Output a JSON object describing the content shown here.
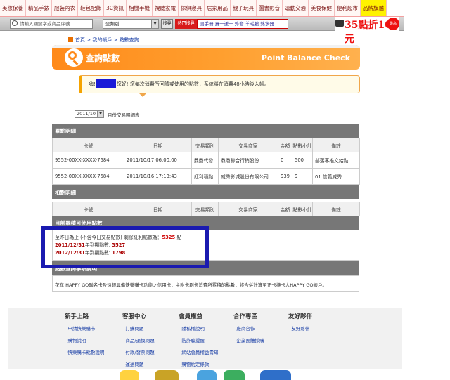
{
  "top_links": "",
  "category_nav": [
    "美妝保養",
    "精品手錶",
    "服裝內衣",
    "鞋包配飾",
    "3C資訊",
    "相機手機",
    "視聽家電",
    "傢俱寢具",
    "居家用品",
    "親子玩具",
    "圖書影音",
    "運動交通",
    "美食保健",
    "便利超市",
    "品牌旗艦"
  ],
  "search": {
    "placeholder": "請輸入關鍵字或商品序號",
    "category": "全類別",
    "button": "搜尋",
    "hot_label": "熱門搜尋",
    "hot_keywords": "國手冊 買一送一 外套 羊毛被 熱水器"
  },
  "promo": {
    "text": "35點折10元",
    "badge": "最高100%"
  },
  "breadcrumb": "首頁 > 我的帳戶 > 點數查詢",
  "banner": {
    "title": "查詢點數",
    "subtitle": "Point Balance Check"
  },
  "greeting": {
    "prefix": "嗨!",
    "suffix": "您好! 您每次消費所回饋或使用的點數，系統將在消費48小時後入帳。"
  },
  "month_select": {
    "value": "2011/10",
    "label": "月份交易明細表"
  },
  "earn_section": {
    "title": "累點明細",
    "columns": [
      "卡號",
      "日期",
      "交易類別",
      "交易商家",
      "金額",
      "點數小計",
      "備註"
    ],
    "rows": [
      [
        "9552-00XX-XXXX-7684",
        "2011/10/17 06:00:00",
        "鼎鼎代發",
        "鼎鼎聯合行銷股份",
        "0",
        "500",
        "部落客推文給點"
      ],
      [
        "9552-00XX-XXXX-7684",
        "2011/10/16 17:13:43",
        "紅利積點",
        "威秀影城股份有限公司",
        "939",
        "9",
        "01 信義威秀"
      ]
    ]
  },
  "deduct_section": {
    "title": "扣點明細",
    "columns": [
      "卡號",
      "日期",
      "交易類別",
      "交易商家",
      "金額",
      "點數小計",
      "備註"
    ]
  },
  "current_points": {
    "title": "目前累積可使用點數",
    "line1_prefix": "至昨日為止 (不含今日交易點數) 剩餘紅利點數為：",
    "total": "5325",
    "unit": "點",
    "exp1_date": "2011/12/31",
    "exp1_label": "年到期點數: ",
    "exp1_points": "3527",
    "exp2_date": "2012/12/31",
    "exp2_label": "年到期點數: ",
    "exp2_points": "1798"
  },
  "notes": {
    "title": "點數查詢事項說明",
    "text": "花旗 HAPPY GO聯名卡及遠銀具備快樂購卡功能之信用卡，主附卡刷卡消費所累積的點數，將合併計算至正卡持卡人HAPPY GO帳戶。"
  },
  "footer": {
    "columns": [
      {
        "title": "新手上路",
        "links": [
          "申請快樂購卡",
          "購物說明",
          "快樂購卡點數說明"
        ]
      },
      {
        "title": "客服中心",
        "links": [
          "訂購問題",
          "商品/退換問題",
          "付款/發票問題",
          "運送問題"
        ]
      },
      {
        "title": "會員權益",
        "links": [
          "隱私權說明",
          "防詐騙提醒",
          "網站會員權益需知",
          "購物約定條款"
        ]
      },
      {
        "title": "合作專區",
        "links": [
          "廠商合作",
          "企業團體採購"
        ]
      },
      {
        "title": "友好夥伴",
        "links": [
          "友好夥伴"
        ]
      }
    ]
  },
  "colors": {
    "orange": "#ff8a1a",
    "highlight": "#1a1ab0",
    "header_gray": "#777777",
    "red": "#d21010"
  }
}
